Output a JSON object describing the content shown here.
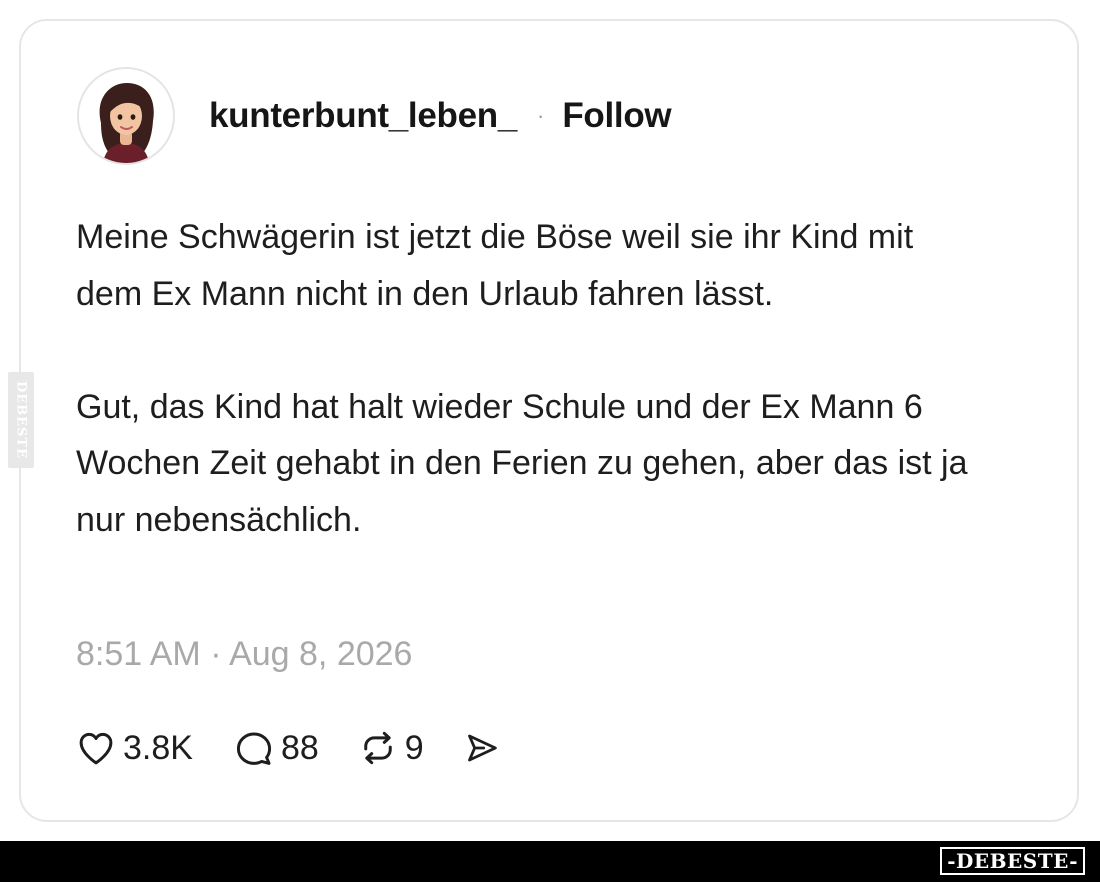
{
  "post": {
    "author": {
      "username": "kunterbunt_leben_",
      "separator": "·",
      "follow_label": "Follow"
    },
    "paragraphs": [
      "Meine Schwägerin ist jetzt die Böse weil sie ihr Kind mit dem Ex Mann nicht in den Urlaub fahren lässt.",
      "Gut, das Kind hat halt wieder Schule und der Ex Mann 6 Wochen Zeit gehabt in den Ferien zu gehen, aber das ist ja nur nebensächlich."
    ],
    "timestamp": "8:51 AM · Aug 8, 2026",
    "actions": {
      "likes": {
        "icon": "heart-icon",
        "count": "3.8K"
      },
      "replies": {
        "icon": "comment-icon",
        "count": "88"
      },
      "reposts": {
        "icon": "repost-icon",
        "count": "9"
      },
      "share": {
        "icon": "send-icon"
      }
    }
  },
  "watermark": {
    "side_text": "DEBESTE",
    "logo_text": "-DEBESTE-"
  },
  "colors": {
    "text": "#1e1e1e",
    "muted": "#a9a9a9",
    "border": "#e6e6e6",
    "bar": "#000000"
  }
}
